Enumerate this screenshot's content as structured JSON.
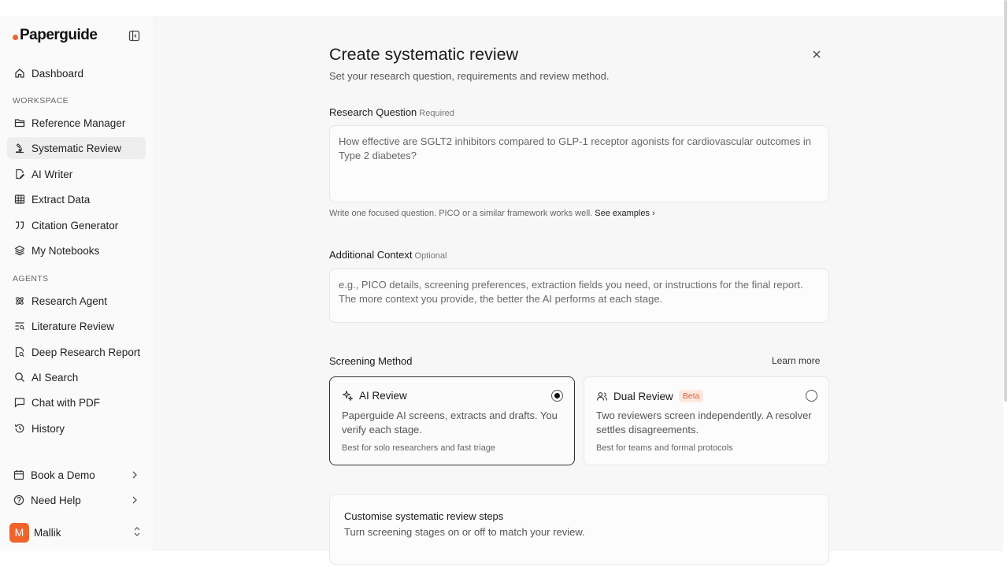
{
  "brand": {
    "name": "Paperguide",
    "accent": "#f0642c"
  },
  "sidebar": {
    "dashboard": "Dashboard",
    "workspace_label": "WORKSPACE",
    "workspace_items": [
      {
        "label": "Reference Manager",
        "icon": "folder-icon"
      },
      {
        "label": "Systematic Review",
        "icon": "microscope-icon",
        "active": true
      },
      {
        "label": "AI Writer",
        "icon": "file-pen-icon"
      },
      {
        "label": "Extract Data",
        "icon": "table-icon"
      },
      {
        "label": "Citation Generator",
        "icon": "quote-icon"
      },
      {
        "label": "My Notebooks",
        "icon": "layers-icon"
      }
    ],
    "agents_label": "AGENTS",
    "agent_items": [
      {
        "label": "Research Agent",
        "icon": "atom-icon"
      },
      {
        "label": "Literature Review",
        "icon": "list-search-icon"
      },
      {
        "label": "Deep Research Report",
        "icon": "file-search-icon"
      },
      {
        "label": "AI Search",
        "icon": "search-icon"
      },
      {
        "label": "Chat with PDF",
        "icon": "chat-icon"
      },
      {
        "label": "History",
        "icon": "history-icon"
      }
    ],
    "book_demo": "Book a Demo",
    "need_help": "Need Help",
    "user": {
      "initial": "M",
      "name": "Mallik"
    }
  },
  "modal": {
    "title": "Create systematic review",
    "subtitle": "Set your research question, requirements and review method.",
    "research_question": {
      "label": "Research Question",
      "tag": "Required",
      "value": "How effective are SGLT2 inhibitors compared to GLP-1 receptor agonists for cardiovascular outcomes in Type 2 diabetes?",
      "hint": "Write one focused question. PICO or a similar framework works well.",
      "hint_link": "See examples"
    },
    "additional_context": {
      "label": "Additional Context",
      "tag": "Optional",
      "placeholder": "e.g., PICO details, screening preferences, extraction fields you need, or instructions for the final report. The more context you provide, the better the AI performs at each stage."
    },
    "screening": {
      "label": "Screening Method",
      "learn_more": "Learn more",
      "options": [
        {
          "title": "AI Review",
          "desc": "Paperguide AI screens, extracts and drafts. You verify each stage.",
          "foot": "Best for solo researchers and fast triage",
          "selected": true
        },
        {
          "title": "Dual Review",
          "badge": "Beta",
          "desc": "Two reviewers screen independently. A resolver settles disagreements.",
          "foot": "Best for teams and formal protocols",
          "selected": false
        }
      ]
    },
    "steps": {
      "title": "Customise systematic review steps",
      "desc": "Turn screening stages on or off to match your review."
    }
  }
}
